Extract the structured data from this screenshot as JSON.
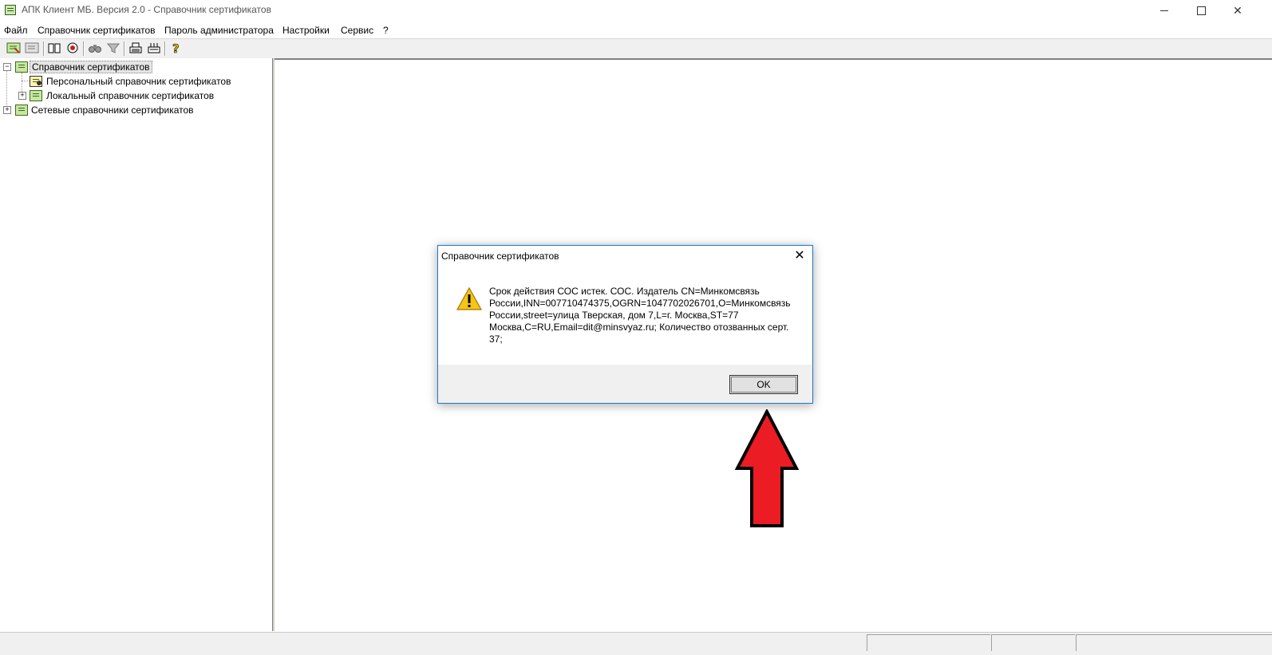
{
  "window": {
    "title": "АПК Клиент МБ. Версия 2.0 - Справочник сертификатов",
    "icon": "certificate-app-icon",
    "minimize_glyph": "",
    "maximize_glyph": "",
    "close_glyph": "✕"
  },
  "menu": {
    "items": [
      "Файл",
      "Справочник сертификатов",
      "Пароль администратора",
      "Настройки",
      "Сервис",
      "?"
    ]
  },
  "toolbar": {
    "buttons": [
      "cert-open-icon",
      "cert-properties-icon",
      "book-icon",
      "cert-revoke-icon",
      "binoculars-icon",
      "filter-icon",
      "print-icon",
      "print-preview-icon",
      "help-icon"
    ]
  },
  "tree": {
    "items": [
      {
        "label": "Справочник сертификатов",
        "expander": "−",
        "selected": true
      },
      {
        "label": "Персональный справочник сертификатов"
      },
      {
        "label": "Локальный справочник сертификатов",
        "expander": "+"
      },
      {
        "label": "Сетевые справочники сертификатов",
        "expander": "+"
      }
    ]
  },
  "dialog": {
    "title": "Справочник сертификатов",
    "close_glyph": "✕",
    "icon": "warning-icon",
    "message": "Срок действия СОС истек.  СОС. Издатель CN=Минкомсвязь России,INN=007710474375,OGRN=1047702026701,O=Минкомсвязь России,street=улица Тверская, дом 7,L=г. Москва,ST=77 Москва,C=RU,Email=dit@minsvyaz.ru; Количество отозванных серт. 37;",
    "ok_label": "OK"
  },
  "annotation": {
    "arrow_color": "#ec1c24",
    "arrow_outline": "#000000",
    "target": "ok-button"
  }
}
